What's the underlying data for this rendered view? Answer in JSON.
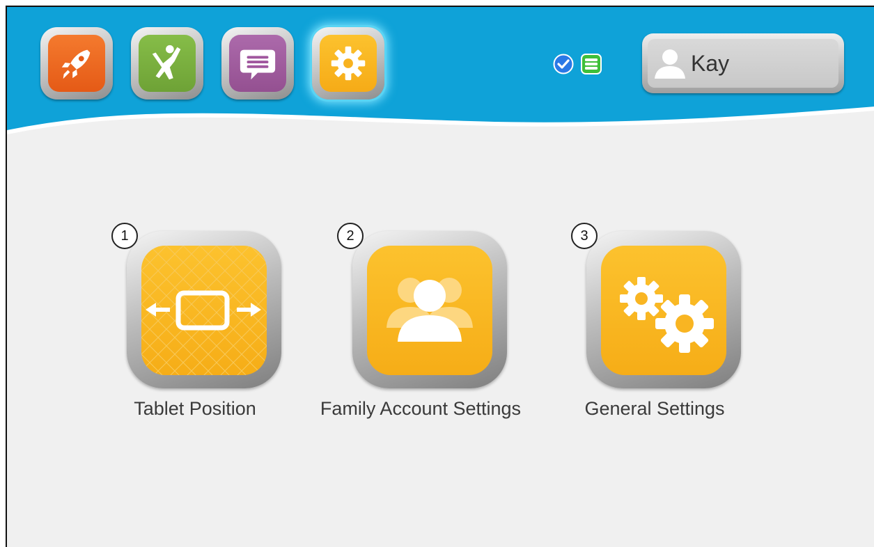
{
  "header": {
    "apps": [
      {
        "name": "rocket-app",
        "icon": "rocket-icon",
        "color": "#ef6a21"
      },
      {
        "name": "activity-app",
        "icon": "jumping-person-icon",
        "color": "#7ab03e"
      },
      {
        "name": "messages-app",
        "icon": "speech-bubble-icon",
        "color": "#9f5e9e"
      },
      {
        "name": "settings-app",
        "icon": "gear-icon",
        "color": "#fbb41f",
        "active": true
      }
    ],
    "status_icons": [
      "checkmark-icon",
      "list-icon"
    ],
    "user": {
      "name": "Kay",
      "icon": "user-silhouette-icon"
    }
  },
  "colors": {
    "header_blue": "#0fa2d8",
    "tile_orange": "#fbb41f",
    "background": "#f0f0f0"
  },
  "main": {
    "options": [
      {
        "number": "1",
        "label": "Tablet Position",
        "icon": "tablet-position-icon"
      },
      {
        "number": "2",
        "label": "Family Account Settings",
        "icon": "family-users-icon"
      },
      {
        "number": "3",
        "label": "General Settings",
        "icon": "gears-icon"
      }
    ]
  }
}
